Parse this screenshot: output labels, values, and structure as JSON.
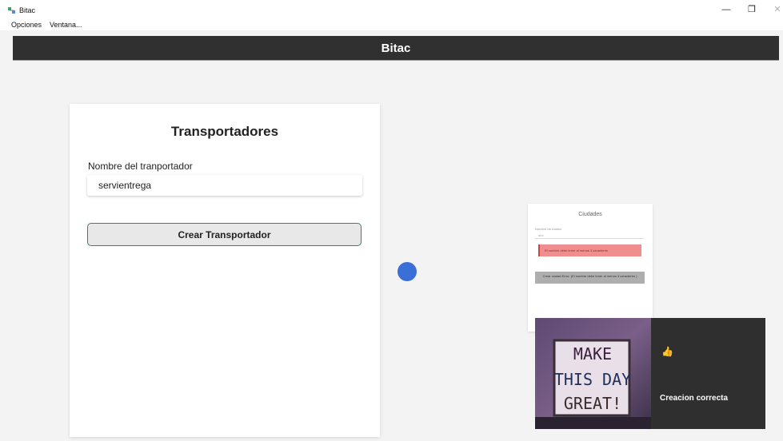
{
  "window": {
    "title": "Bitac",
    "controls": {
      "minimize": "—",
      "maximize": "❐",
      "close": "✕"
    }
  },
  "menubar": {
    "items": [
      "Opciones",
      "Ventana..."
    ]
  },
  "header": {
    "title": "Bitac"
  },
  "form": {
    "title": "Transportadores",
    "field_label": "Nombre del tranportador",
    "field_value": "servientrega",
    "submit_label": "Crear Transportador"
  },
  "preview": {
    "title": "Ciudades",
    "field_label": "Nombre de ciudad",
    "field_value": "abs",
    "error_text": "El nombre debe tener al menos 3 caracteres",
    "button_text": "Crear ciudad  Error: (El nombre debe tener al menos 3 caracteres )"
  },
  "toast": {
    "image_lines": [
      "MAKE",
      "THIS DAY",
      "GREAT!"
    ],
    "icon": "thumbs-up-icon",
    "message": "Creacion correcta"
  },
  "colors": {
    "header_bg": "#303030",
    "button_border": "#2e8b57",
    "spinner": "#3a6fd8",
    "toast_bg": "#2f2f2f"
  }
}
